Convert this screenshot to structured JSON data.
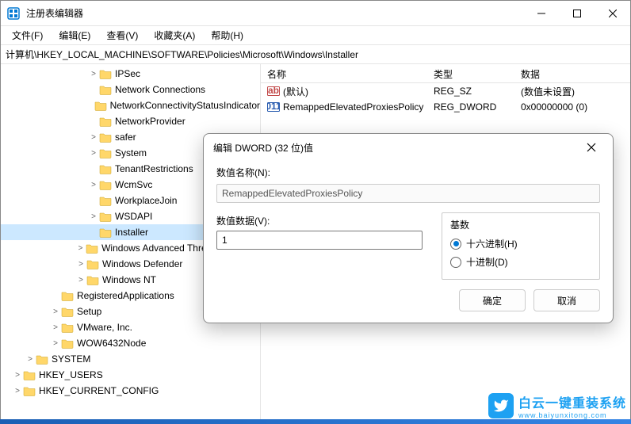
{
  "window": {
    "title": "注册表编辑器"
  },
  "menu": {
    "file": "文件(F)",
    "edit": "编辑(E)",
    "view": "查看(V)",
    "favorites": "收藏夹(A)",
    "help": "帮助(H)"
  },
  "address": "计算机\\HKEY_LOCAL_MACHINE\\SOFTWARE\\Policies\\Microsoft\\Windows\\Installer",
  "tree": [
    {
      "indent": 110,
      "toggle": ">",
      "label": "IPSec",
      "selected": false
    },
    {
      "indent": 110,
      "toggle": "",
      "label": "Network Connections",
      "selected": false
    },
    {
      "indent": 110,
      "toggle": "",
      "label": "NetworkConnectivityStatusIndicator",
      "selected": false
    },
    {
      "indent": 110,
      "toggle": "",
      "label": "NetworkProvider",
      "selected": false
    },
    {
      "indent": 110,
      "toggle": ">",
      "label": "safer",
      "selected": false
    },
    {
      "indent": 110,
      "toggle": ">",
      "label": "System",
      "selected": false
    },
    {
      "indent": 110,
      "toggle": "",
      "label": "TenantRestrictions",
      "selected": false
    },
    {
      "indent": 110,
      "toggle": ">",
      "label": "WcmSvc",
      "selected": false
    },
    {
      "indent": 110,
      "toggle": "",
      "label": "WorkplaceJoin",
      "selected": false
    },
    {
      "indent": 110,
      "toggle": ">",
      "label": "WSDAPI",
      "selected": false
    },
    {
      "indent": 110,
      "toggle": "",
      "label": "Installer",
      "selected": true
    },
    {
      "indent": 94,
      "toggle": ">",
      "label": "Windows Advanced Threat Protection",
      "selected": false
    },
    {
      "indent": 94,
      "toggle": ">",
      "label": "Windows Defender",
      "selected": false
    },
    {
      "indent": 94,
      "toggle": ">",
      "label": "Windows NT",
      "selected": false
    },
    {
      "indent": 62,
      "toggle": "",
      "label": "RegisteredApplications",
      "selected": false
    },
    {
      "indent": 62,
      "toggle": ">",
      "label": "Setup",
      "selected": false
    },
    {
      "indent": 62,
      "toggle": ">",
      "label": "VMware, Inc.",
      "selected": false
    },
    {
      "indent": 62,
      "toggle": ">",
      "label": "WOW6432Node",
      "selected": false
    },
    {
      "indent": 30,
      "toggle": ">",
      "label": "SYSTEM",
      "selected": false
    },
    {
      "indent": 14,
      "toggle": ">",
      "label": "HKEY_USERS",
      "selected": false
    },
    {
      "indent": 14,
      "toggle": ">",
      "label": "HKEY_CURRENT_CONFIG",
      "selected": false
    }
  ],
  "list": {
    "headers": {
      "name": "名称",
      "type": "类型",
      "data": "数据"
    },
    "rows": [
      {
        "icon": "ab",
        "name": "(默认)",
        "type": "REG_SZ",
        "data": "(数值未设置)"
      },
      {
        "icon": "01",
        "name": "RemappedElevatedProxiesPolicy",
        "type": "REG_DWORD",
        "data": "0x00000000 (0)"
      }
    ]
  },
  "dialog": {
    "title": "编辑 DWORD (32 位)值",
    "name_label": "数值名称(N):",
    "name_value": "RemappedElevatedProxiesPolicy",
    "data_label": "数值数据(V):",
    "data_value": "1",
    "base_label": "基数",
    "radio_hex": "十六进制(H)",
    "radio_dec": "十进制(D)",
    "radio_selected": "hex",
    "ok": "确定",
    "cancel": "取消"
  },
  "watermark": {
    "main": "白云一键重装系统",
    "sub": "www.baiyunxitong.com"
  }
}
